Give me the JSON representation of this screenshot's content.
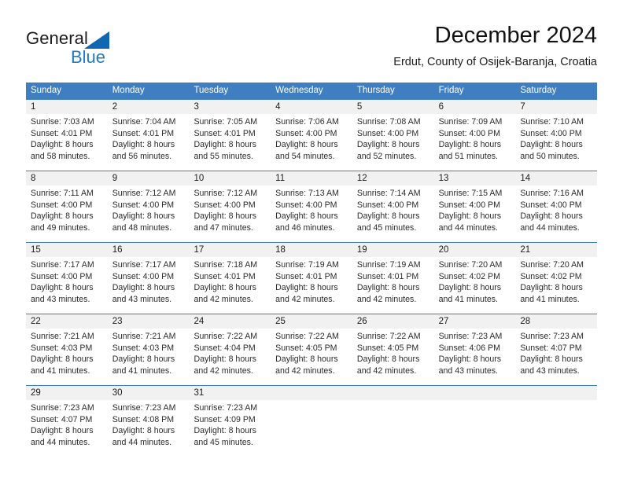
{
  "brand": {
    "name_primary": "General",
    "name_secondary": "Blue",
    "logo_icon": "triangle-flag-icon",
    "color_primary": "#1c1c1c",
    "color_secondary": "#1f7bc4"
  },
  "header": {
    "title": "December 2024",
    "subtitle": "Erdut, County of Osijek-Baranja, Croatia"
  },
  "theme": {
    "header_bar": "#3f7fc1",
    "day_number_band": "#f1f1f1",
    "text": "#2b2b2b"
  },
  "calendar": {
    "weekday_headers": [
      "Sunday",
      "Monday",
      "Tuesday",
      "Wednesday",
      "Thursday",
      "Friday",
      "Saturday"
    ],
    "weeks": [
      [
        {
          "day": "1",
          "sunrise": "Sunrise: 7:03 AM",
          "sunset": "Sunset: 4:01 PM",
          "daylight_line1": "Daylight: 8 hours",
          "daylight_line2": "and 58 minutes."
        },
        {
          "day": "2",
          "sunrise": "Sunrise: 7:04 AM",
          "sunset": "Sunset: 4:01 PM",
          "daylight_line1": "Daylight: 8 hours",
          "daylight_line2": "and 56 minutes."
        },
        {
          "day": "3",
          "sunrise": "Sunrise: 7:05 AM",
          "sunset": "Sunset: 4:01 PM",
          "daylight_line1": "Daylight: 8 hours",
          "daylight_line2": "and 55 minutes."
        },
        {
          "day": "4",
          "sunrise": "Sunrise: 7:06 AM",
          "sunset": "Sunset: 4:00 PM",
          "daylight_line1": "Daylight: 8 hours",
          "daylight_line2": "and 54 minutes."
        },
        {
          "day": "5",
          "sunrise": "Sunrise: 7:08 AM",
          "sunset": "Sunset: 4:00 PM",
          "daylight_line1": "Daylight: 8 hours",
          "daylight_line2": "and 52 minutes."
        },
        {
          "day": "6",
          "sunrise": "Sunrise: 7:09 AM",
          "sunset": "Sunset: 4:00 PM",
          "daylight_line1": "Daylight: 8 hours",
          "daylight_line2": "and 51 minutes."
        },
        {
          "day": "7",
          "sunrise": "Sunrise: 7:10 AM",
          "sunset": "Sunset: 4:00 PM",
          "daylight_line1": "Daylight: 8 hours",
          "daylight_line2": "and 50 minutes."
        }
      ],
      [
        {
          "day": "8",
          "sunrise": "Sunrise: 7:11 AM",
          "sunset": "Sunset: 4:00 PM",
          "daylight_line1": "Daylight: 8 hours",
          "daylight_line2": "and 49 minutes."
        },
        {
          "day": "9",
          "sunrise": "Sunrise: 7:12 AM",
          "sunset": "Sunset: 4:00 PM",
          "daylight_line1": "Daylight: 8 hours",
          "daylight_line2": "and 48 minutes."
        },
        {
          "day": "10",
          "sunrise": "Sunrise: 7:12 AM",
          "sunset": "Sunset: 4:00 PM",
          "daylight_line1": "Daylight: 8 hours",
          "daylight_line2": "and 47 minutes."
        },
        {
          "day": "11",
          "sunrise": "Sunrise: 7:13 AM",
          "sunset": "Sunset: 4:00 PM",
          "daylight_line1": "Daylight: 8 hours",
          "daylight_line2": "and 46 minutes."
        },
        {
          "day": "12",
          "sunrise": "Sunrise: 7:14 AM",
          "sunset": "Sunset: 4:00 PM",
          "daylight_line1": "Daylight: 8 hours",
          "daylight_line2": "and 45 minutes."
        },
        {
          "day": "13",
          "sunrise": "Sunrise: 7:15 AM",
          "sunset": "Sunset: 4:00 PM",
          "daylight_line1": "Daylight: 8 hours",
          "daylight_line2": "and 44 minutes."
        },
        {
          "day": "14",
          "sunrise": "Sunrise: 7:16 AM",
          "sunset": "Sunset: 4:00 PM",
          "daylight_line1": "Daylight: 8 hours",
          "daylight_line2": "and 44 minutes."
        }
      ],
      [
        {
          "day": "15",
          "sunrise": "Sunrise: 7:17 AM",
          "sunset": "Sunset: 4:00 PM",
          "daylight_line1": "Daylight: 8 hours",
          "daylight_line2": "and 43 minutes."
        },
        {
          "day": "16",
          "sunrise": "Sunrise: 7:17 AM",
          "sunset": "Sunset: 4:00 PM",
          "daylight_line1": "Daylight: 8 hours",
          "daylight_line2": "and 43 minutes."
        },
        {
          "day": "17",
          "sunrise": "Sunrise: 7:18 AM",
          "sunset": "Sunset: 4:01 PM",
          "daylight_line1": "Daylight: 8 hours",
          "daylight_line2": "and 42 minutes."
        },
        {
          "day": "18",
          "sunrise": "Sunrise: 7:19 AM",
          "sunset": "Sunset: 4:01 PM",
          "daylight_line1": "Daylight: 8 hours",
          "daylight_line2": "and 42 minutes."
        },
        {
          "day": "19",
          "sunrise": "Sunrise: 7:19 AM",
          "sunset": "Sunset: 4:01 PM",
          "daylight_line1": "Daylight: 8 hours",
          "daylight_line2": "and 42 minutes."
        },
        {
          "day": "20",
          "sunrise": "Sunrise: 7:20 AM",
          "sunset": "Sunset: 4:02 PM",
          "daylight_line1": "Daylight: 8 hours",
          "daylight_line2": "and 41 minutes."
        },
        {
          "day": "21",
          "sunrise": "Sunrise: 7:20 AM",
          "sunset": "Sunset: 4:02 PM",
          "daylight_line1": "Daylight: 8 hours",
          "daylight_line2": "and 41 minutes."
        }
      ],
      [
        {
          "day": "22",
          "sunrise": "Sunrise: 7:21 AM",
          "sunset": "Sunset: 4:03 PM",
          "daylight_line1": "Daylight: 8 hours",
          "daylight_line2": "and 41 minutes."
        },
        {
          "day": "23",
          "sunrise": "Sunrise: 7:21 AM",
          "sunset": "Sunset: 4:03 PM",
          "daylight_line1": "Daylight: 8 hours",
          "daylight_line2": "and 41 minutes."
        },
        {
          "day": "24",
          "sunrise": "Sunrise: 7:22 AM",
          "sunset": "Sunset: 4:04 PM",
          "daylight_line1": "Daylight: 8 hours",
          "daylight_line2": "and 42 minutes."
        },
        {
          "day": "25",
          "sunrise": "Sunrise: 7:22 AM",
          "sunset": "Sunset: 4:05 PM",
          "daylight_line1": "Daylight: 8 hours",
          "daylight_line2": "and 42 minutes."
        },
        {
          "day": "26",
          "sunrise": "Sunrise: 7:22 AM",
          "sunset": "Sunset: 4:05 PM",
          "daylight_line1": "Daylight: 8 hours",
          "daylight_line2": "and 42 minutes."
        },
        {
          "day": "27",
          "sunrise": "Sunrise: 7:23 AM",
          "sunset": "Sunset: 4:06 PM",
          "daylight_line1": "Daylight: 8 hours",
          "daylight_line2": "and 43 minutes."
        },
        {
          "day": "28",
          "sunrise": "Sunrise: 7:23 AM",
          "sunset": "Sunset: 4:07 PM",
          "daylight_line1": "Daylight: 8 hours",
          "daylight_line2": "and 43 minutes."
        }
      ],
      [
        {
          "day": "29",
          "sunrise": "Sunrise: 7:23 AM",
          "sunset": "Sunset: 4:07 PM",
          "daylight_line1": "Daylight: 8 hours",
          "daylight_line2": "and 44 minutes."
        },
        {
          "day": "30",
          "sunrise": "Sunrise: 7:23 AM",
          "sunset": "Sunset: 4:08 PM",
          "daylight_line1": "Daylight: 8 hours",
          "daylight_line2": "and 44 minutes."
        },
        {
          "day": "31",
          "sunrise": "Sunrise: 7:23 AM",
          "sunset": "Sunset: 4:09 PM",
          "daylight_line1": "Daylight: 8 hours",
          "daylight_line2": "and 45 minutes."
        },
        {
          "day": "",
          "sunrise": "",
          "sunset": "",
          "daylight_line1": "",
          "daylight_line2": ""
        },
        {
          "day": "",
          "sunrise": "",
          "sunset": "",
          "daylight_line1": "",
          "daylight_line2": ""
        },
        {
          "day": "",
          "sunrise": "",
          "sunset": "",
          "daylight_line1": "",
          "daylight_line2": ""
        },
        {
          "day": "",
          "sunrise": "",
          "sunset": "",
          "daylight_line1": "",
          "daylight_line2": ""
        }
      ]
    ]
  }
}
